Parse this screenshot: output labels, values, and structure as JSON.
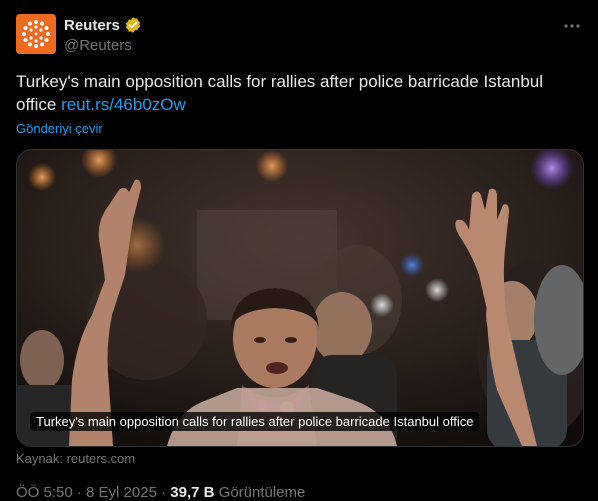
{
  "author": {
    "display_name": "Reuters",
    "handle": "@Reuters",
    "verified_badge_color": "#e2b719",
    "avatar_color": "#ee6a1f"
  },
  "tweet": {
    "text": "Turkey's main opposition calls for rallies after police barricade Istanbul office ",
    "link_text": "reut.rs/46b0zOw",
    "translate_label": "Gönderiyi çevir"
  },
  "media": {
    "caption": "Turkey's main opposition calls for rallies after police barricade Istanbul office"
  },
  "source_label": "Kaynak: reuters.com",
  "meta": {
    "time": "ÖÖ 5:50",
    "separator1": " · ",
    "date": "8 Eyl 2025",
    "separator2": " · ",
    "views": "39,7 B",
    "views_label": " Görüntüleme"
  },
  "icons": {
    "more": "more-horizontal-icon",
    "verified": "verified-badge-icon"
  },
  "link_color": "#1d9bf0"
}
